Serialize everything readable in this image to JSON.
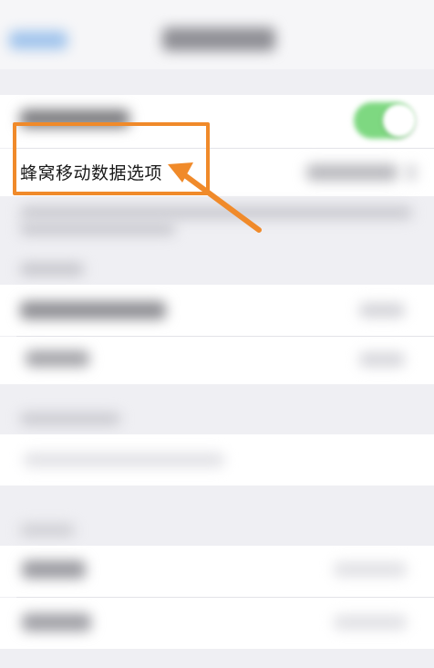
{
  "highlight": {
    "color": "#f08a2a"
  },
  "settings": {
    "cellular_data_options_label": "蜂窝移动数据选项"
  },
  "icons": {
    "arrow": "arrow-pointer-icon"
  }
}
